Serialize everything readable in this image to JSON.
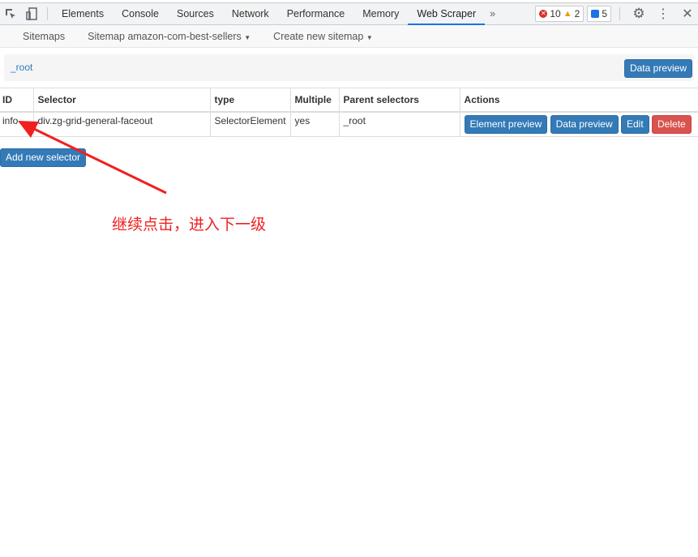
{
  "devtools": {
    "tabs": [
      "Elements",
      "Console",
      "Sources",
      "Network",
      "Performance",
      "Memory",
      "Web Scraper"
    ],
    "active_tab": "Web Scraper",
    "errors": "10",
    "warnings": "2",
    "messages": "5"
  },
  "nav": {
    "sitemaps": "Sitemaps",
    "sitemap": "Sitemap amazon-com-best-sellers",
    "create": "Create new sitemap"
  },
  "breadcrumb": {
    "root": "_root",
    "data_preview": "Data preview"
  },
  "table": {
    "headers": [
      "ID",
      "Selector",
      "type",
      "Multiple",
      "Parent selectors",
      "Actions"
    ],
    "rows": [
      {
        "id": "info",
        "selector": "div.zg-grid-general-faceout",
        "type": "SelectorElement",
        "multiple": "yes",
        "parent": "_root"
      }
    ],
    "actions": {
      "element_preview": "Element preview",
      "data_preview": "Data preview",
      "edit": "Edit",
      "delete": "Delete"
    }
  },
  "add_selector": "Add new selector",
  "annotation": "继续点击，进入下一级"
}
